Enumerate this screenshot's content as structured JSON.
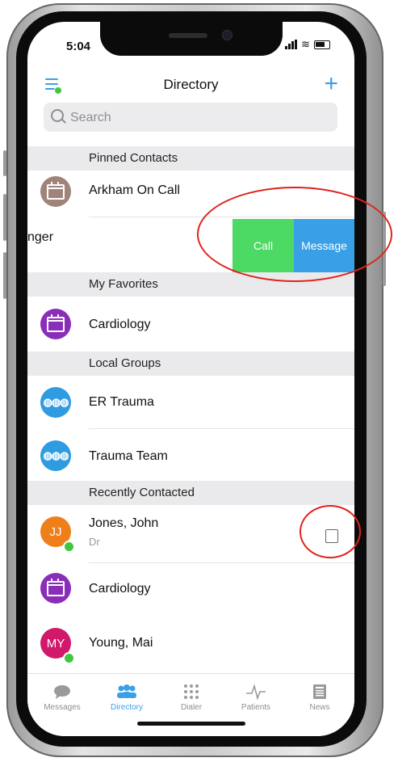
{
  "status": {
    "time": "5:04"
  },
  "nav": {
    "title": "Directory"
  },
  "search": {
    "placeholder": "Search"
  },
  "sections": {
    "pinned": "Pinned Contacts",
    "favorites": "My Favorites",
    "local": "Local Groups",
    "recent": "Recently Contacted"
  },
  "pinned": [
    {
      "label": "Arkham On Call",
      "avatar": "calendar-icon",
      "color": "#a0837a"
    },
    {
      "label": "nger"
    }
  ],
  "swipe_actions": {
    "call": "Call",
    "message": "Message"
  },
  "favorites": [
    {
      "label": "Cardiology",
      "avatar": "calendar-icon",
      "color": "#8a2db8"
    }
  ],
  "local_groups": [
    {
      "label": "ER Trauma",
      "avatar": "group-icon",
      "color": "#2f9be0"
    },
    {
      "label": "Trauma Team",
      "avatar": "group-icon",
      "color": "#2f9be0"
    }
  ],
  "recent": [
    {
      "label": "Jones, John",
      "sub": "Dr",
      "initials": "JJ",
      "color": "#ee7f1b",
      "online": true
    },
    {
      "label": "Cardiology",
      "avatar": "calendar-icon",
      "color": "#8a2db8"
    },
    {
      "label": "Young, Mai",
      "initials": "MY",
      "color": "#d1186a",
      "online": true
    }
  ],
  "tabs": [
    {
      "label": "Messages",
      "icon": "chat-bubble-icon",
      "active": false
    },
    {
      "label": "Directory",
      "icon": "people-icon",
      "active": true
    },
    {
      "label": "Dialer",
      "icon": "keypad-icon",
      "active": false
    },
    {
      "label": "Patients",
      "icon": "pulse-icon",
      "active": false
    },
    {
      "label": "News",
      "icon": "newspaper-icon",
      "active": false
    }
  ],
  "colors": {
    "accent": "#3aa0e6",
    "call": "#4cd964",
    "annotation": "#e0231c"
  }
}
